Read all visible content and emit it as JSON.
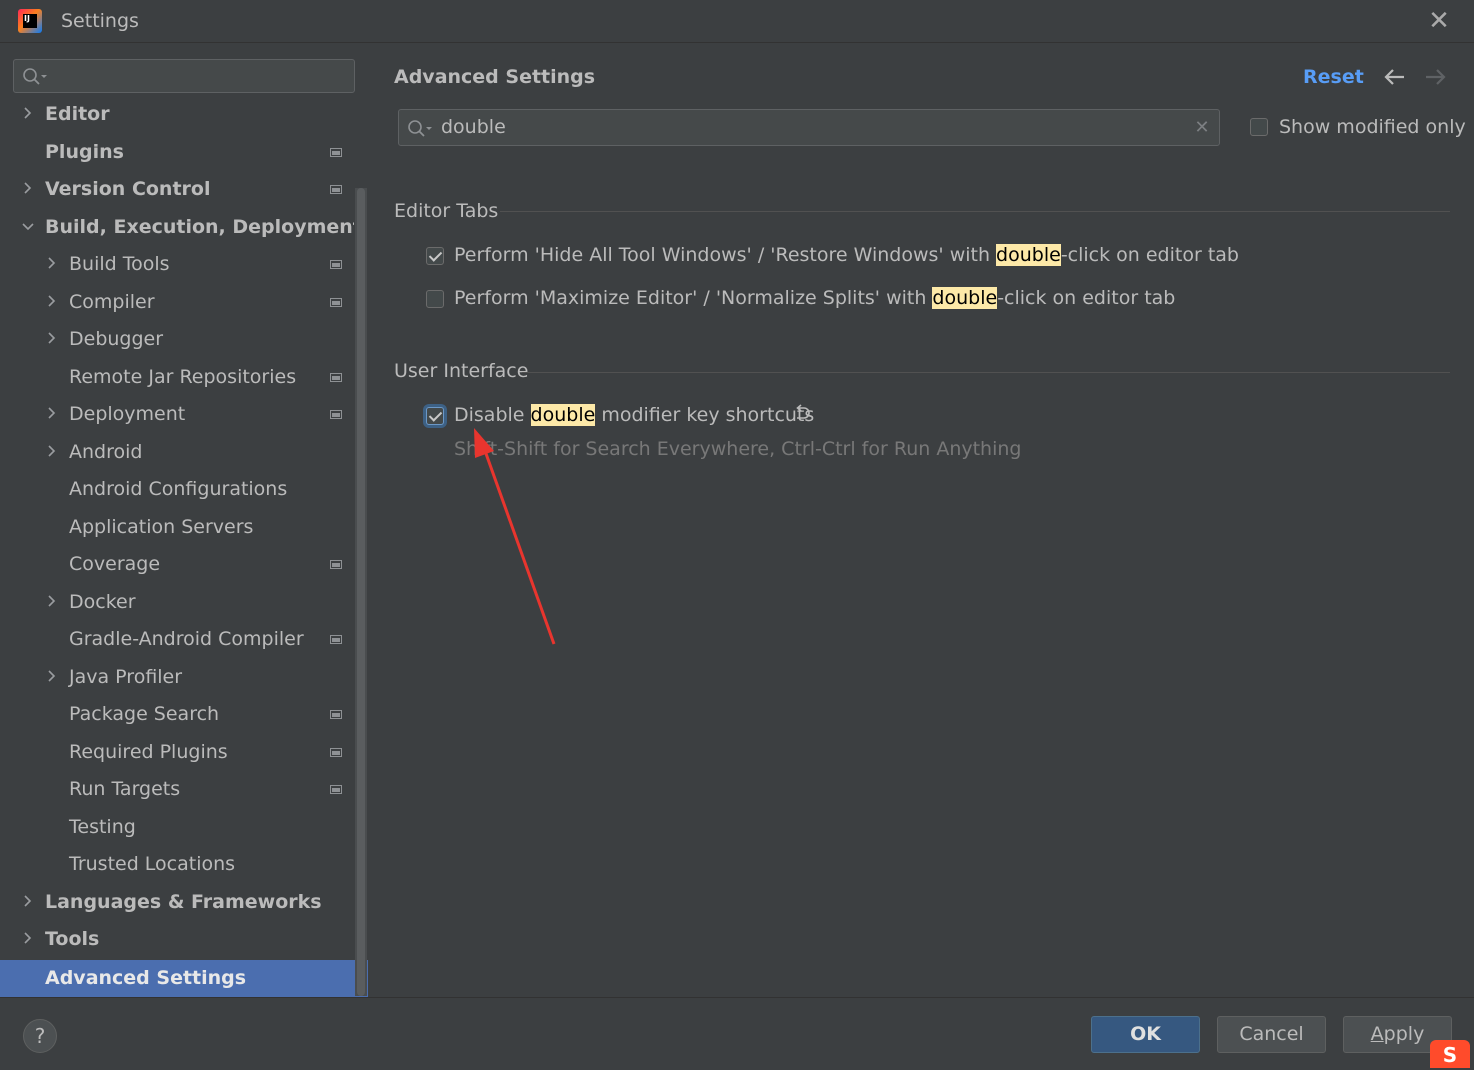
{
  "window": {
    "title": "Settings",
    "close_icon": "close-icon",
    "logo_text": "IJ"
  },
  "sidebar": {
    "search": {
      "value": "",
      "placeholder": ""
    },
    "items": [
      {
        "label": "Editor",
        "level": 0,
        "expandable": true,
        "expanded": false,
        "project_icon": false
      },
      {
        "label": "Plugins",
        "level": 0,
        "expandable": false,
        "project_icon": true
      },
      {
        "label": "Version Control",
        "level": 0,
        "expandable": true,
        "expanded": false,
        "project_icon": true
      },
      {
        "label": "Build, Execution, Deployment",
        "level": 0,
        "expandable": true,
        "expanded": true,
        "project_icon": false
      },
      {
        "label": "Build Tools",
        "level": 1,
        "expandable": true,
        "expanded": false,
        "project_icon": true
      },
      {
        "label": "Compiler",
        "level": 1,
        "expandable": true,
        "expanded": false,
        "project_icon": true
      },
      {
        "label": "Debugger",
        "level": 1,
        "expandable": true,
        "expanded": false,
        "project_icon": false
      },
      {
        "label": "Remote Jar Repositories",
        "level": 1,
        "expandable": false,
        "project_icon": true
      },
      {
        "label": "Deployment",
        "level": 1,
        "expandable": true,
        "expanded": false,
        "project_icon": true
      },
      {
        "label": "Android",
        "level": 1,
        "expandable": true,
        "expanded": false,
        "project_icon": false
      },
      {
        "label": "Android Configurations",
        "level": 1,
        "expandable": false,
        "project_icon": false
      },
      {
        "label": "Application Servers",
        "level": 1,
        "expandable": false,
        "project_icon": false
      },
      {
        "label": "Coverage",
        "level": 1,
        "expandable": false,
        "project_icon": true
      },
      {
        "label": "Docker",
        "level": 1,
        "expandable": true,
        "expanded": false,
        "project_icon": false
      },
      {
        "label": "Gradle-Android Compiler",
        "level": 1,
        "expandable": false,
        "project_icon": true
      },
      {
        "label": "Java Profiler",
        "level": 1,
        "expandable": true,
        "expanded": false,
        "project_icon": false
      },
      {
        "label": "Package Search",
        "level": 1,
        "expandable": false,
        "project_icon": true
      },
      {
        "label": "Required Plugins",
        "level": 1,
        "expandable": false,
        "project_icon": true
      },
      {
        "label": "Run Targets",
        "level": 1,
        "expandable": false,
        "project_icon": true
      },
      {
        "label": "Testing",
        "level": 1,
        "expandable": false,
        "project_icon": false
      },
      {
        "label": "Trusted Locations",
        "level": 1,
        "expandable": false,
        "project_icon": false
      },
      {
        "label": "Languages & Frameworks",
        "level": 0,
        "expandable": true,
        "expanded": false,
        "project_icon": false
      },
      {
        "label": "Tools",
        "level": 0,
        "expandable": true,
        "expanded": false,
        "project_icon": false
      }
    ],
    "selected": {
      "label": "Advanced Settings"
    }
  },
  "main": {
    "title": "Advanced Settings",
    "reset_label": "Reset",
    "back_icon": "arrow-left-icon",
    "forward_icon": "arrow-right-icon",
    "search": {
      "value": "double",
      "clear_icon": "clear-icon"
    },
    "show_modified": {
      "label": "Show modified only",
      "checked": false
    },
    "sections": [
      {
        "title": "Editor Tabs",
        "options": [
          {
            "pre": "Perform 'Hide All Tool Windows' / 'Restore Windows' with ",
            "match": "double",
            "post": "-click on editor tab",
            "checked": true
          },
          {
            "pre": "Perform 'Maximize Editor' / 'Normalize Splits' with ",
            "match": "double",
            "post": "-click on editor tab",
            "checked": false
          }
        ]
      },
      {
        "title": "User Interface",
        "options": [
          {
            "pre": "Disable ",
            "match": "double",
            "post": " modifier key shortcuts",
            "checked": true,
            "modified": true,
            "hint": "Shift-Shift for Search Everywhere, Ctrl-Ctrl for Run Anything"
          }
        ]
      }
    ]
  },
  "buttons": {
    "ok": "OK",
    "cancel": "Cancel",
    "apply_mnemonic": "A",
    "apply_rest": "pply",
    "help": "?"
  },
  "colors": {
    "background": "#3c3f41",
    "selection": "#4b6eaf",
    "link": "#589df6",
    "highlight": "#fde9a8",
    "annotation_arrow": "#e8352e"
  },
  "ime_logo": "S"
}
